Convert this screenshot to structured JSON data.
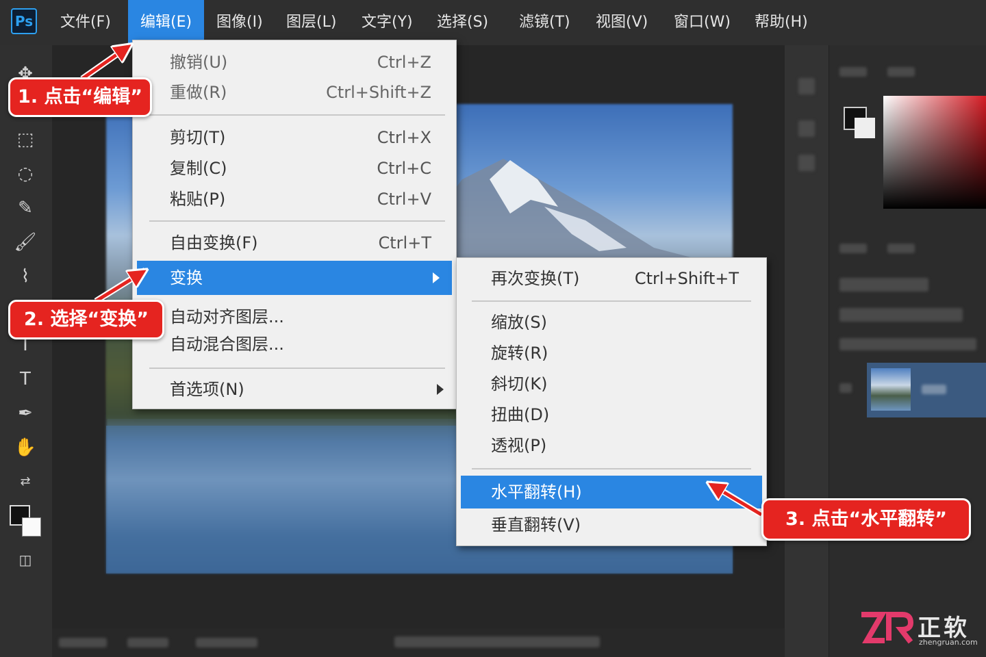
{
  "app": {
    "logo": "Ps"
  },
  "menubar": {
    "items": [
      {
        "label": "文件(F)"
      },
      {
        "label": "编辑(E)"
      },
      {
        "label": "图像(I)"
      },
      {
        "label": "图层(L)"
      },
      {
        "label": "文字(Y)"
      },
      {
        "label": "选择(S)"
      },
      {
        "label": "滤镜(T)"
      },
      {
        "label": "视图(V)"
      },
      {
        "label": "窗口(W)"
      },
      {
        "label": "帮助(H)"
      }
    ]
  },
  "edit_menu": {
    "items": [
      {
        "label": "撤销(U)",
        "shortcut": "Ctrl+Z"
      },
      {
        "label": "重做(R)",
        "shortcut": "Ctrl+Shift+Z"
      },
      {
        "label": "剪切(T)",
        "shortcut": "Ctrl+X"
      },
      {
        "label": "复制(C)",
        "shortcut": "Ctrl+C"
      },
      {
        "label": "粘贴(P)",
        "shortcut": "Ctrl+V"
      },
      {
        "label": "自由变换(F)",
        "shortcut": "Ctrl+T"
      },
      {
        "label": "变换"
      },
      {
        "label": "自动对齐图层..."
      },
      {
        "label": "自动混合图层..."
      },
      {
        "label": "首选项(N)"
      }
    ]
  },
  "transform_submenu": {
    "items": [
      {
        "label": "再次变换(T)",
        "shortcut": "Ctrl+Shift+T"
      },
      {
        "label": "缩放(S)"
      },
      {
        "label": "旋转(R)"
      },
      {
        "label": "斜切(K)"
      },
      {
        "label": "扭曲(D)"
      },
      {
        "label": "透视(P)"
      },
      {
        "label": "水平翻转(H)"
      },
      {
        "label": "垂直翻转(V)"
      }
    ]
  },
  "callouts": {
    "step1": "1. 点击“编辑”",
    "step2": "2. 选择“变换”",
    "step3": "3. 点击“水平翻转”"
  },
  "watermark": {
    "brand": "正软",
    "site": "zhengruan.com"
  },
  "colors": {
    "accent": "#2a86e2",
    "callout": "#e52420",
    "menu_bg": "#f0f0f0"
  },
  "icons": [
    "move-icon",
    "marquee-icon",
    "lasso-icon",
    "brush-icon",
    "stamp-icon",
    "type-icon",
    "pen-icon",
    "hand-icon",
    "submenu-arrow-icon"
  ]
}
